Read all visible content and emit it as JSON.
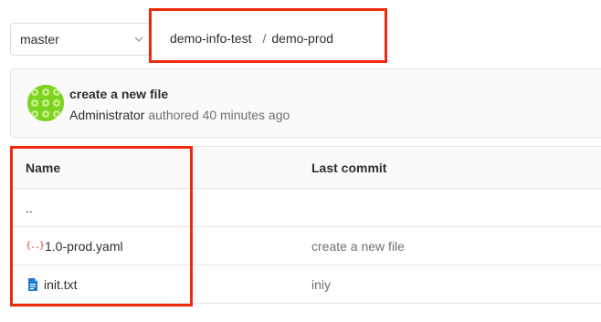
{
  "branch": {
    "selected": "master"
  },
  "breadcrumb": {
    "project": "demo-info-test",
    "separator": "/",
    "folder": "demo-prod"
  },
  "commit": {
    "title": "create a new file",
    "author": "Administrator",
    "action": "authored",
    "time": "40 minutes ago"
  },
  "table": {
    "headers": {
      "name": "Name",
      "last_commit": "Last commit"
    },
    "parent": "..",
    "files": [
      {
        "name": "1.0-prod.yaml",
        "icon": "yaml-file-icon",
        "commit": "create a new file"
      },
      {
        "name": "init.txt",
        "icon": "text-file-icon",
        "commit": "iniy"
      }
    ]
  },
  "colors": {
    "highlight": "#ee2a0a",
    "avatar": "#7ed321",
    "yaml_icon": "#db3b21",
    "text_icon": "#1f78d1"
  }
}
